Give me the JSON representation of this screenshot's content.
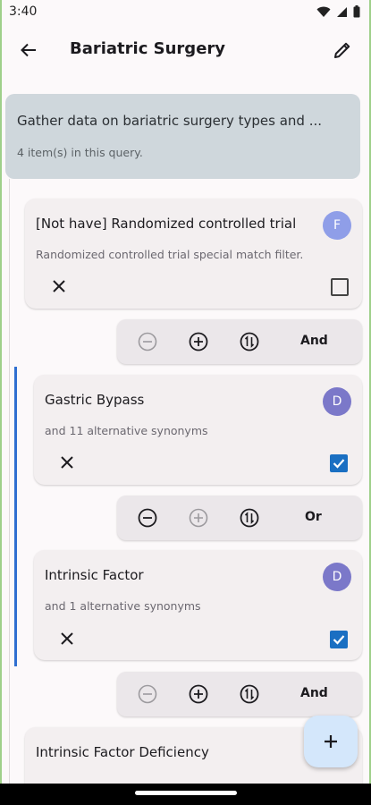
{
  "status_bar": {
    "time": "3:40"
  },
  "app_bar": {
    "title": "Bariatric Surgery"
  },
  "query": {
    "title": "Gather data on bariatric surgery types and ...",
    "count_text": "4 item(s) in this query."
  },
  "items": [
    {
      "title": "[Not have] Randomized controlled trial",
      "subtitle": "Randomized controlled trial special match filter.",
      "avatar": "F",
      "avatar_color": "#8f9ee8",
      "checked": false
    },
    {
      "title": "Gastric Bypass",
      "subtitle": "and 11 alternative synonyms",
      "avatar": "D",
      "avatar_color": "#7b78c9",
      "checked": true
    },
    {
      "title": "Intrinsic Factor",
      "subtitle": "and 1 alternative synonyms",
      "avatar": "D",
      "avatar_color": "#7b78c9",
      "checked": true
    },
    {
      "title": "Intrinsic Factor Deficiency"
    }
  ],
  "operators": [
    {
      "label": "And",
      "minus_enabled": false,
      "plus_enabled": true
    },
    {
      "label": "Or",
      "minus_enabled": true,
      "plus_enabled": false
    },
    {
      "label": "And",
      "minus_enabled": false,
      "plus_enabled": true
    }
  ],
  "icons": {
    "back": "arrow-left-icon",
    "edit": "pencil-icon",
    "remove": "close-icon",
    "minus": "circle-minus-icon",
    "plus": "circle-plus-icon",
    "swap": "circle-swap-icon",
    "fab": "plus-icon"
  },
  "colors": {
    "accent": "#1a6fc2",
    "group_line": "#2f6fd0",
    "header_bg": "#cfd7dc",
    "fab_bg": "#d4e7fb"
  }
}
